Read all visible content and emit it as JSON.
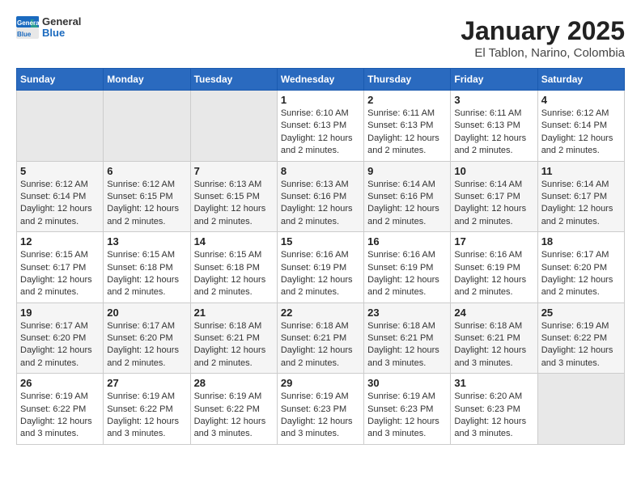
{
  "header": {
    "logo_line1": "General",
    "logo_line2": "Blue",
    "month": "January 2025",
    "location": "El Tablon, Narino, Colombia"
  },
  "weekdays": [
    "Sunday",
    "Monday",
    "Tuesday",
    "Wednesday",
    "Thursday",
    "Friday",
    "Saturday"
  ],
  "weeks": [
    [
      {
        "day": "",
        "info": ""
      },
      {
        "day": "",
        "info": ""
      },
      {
        "day": "",
        "info": ""
      },
      {
        "day": "1",
        "info": "Sunrise: 6:10 AM\nSunset: 6:13 PM\nDaylight: 12 hours and 2 minutes."
      },
      {
        "day": "2",
        "info": "Sunrise: 6:11 AM\nSunset: 6:13 PM\nDaylight: 12 hours and 2 minutes."
      },
      {
        "day": "3",
        "info": "Sunrise: 6:11 AM\nSunset: 6:13 PM\nDaylight: 12 hours and 2 minutes."
      },
      {
        "day": "4",
        "info": "Sunrise: 6:12 AM\nSunset: 6:14 PM\nDaylight: 12 hours and 2 minutes."
      }
    ],
    [
      {
        "day": "5",
        "info": "Sunrise: 6:12 AM\nSunset: 6:14 PM\nDaylight: 12 hours and 2 minutes."
      },
      {
        "day": "6",
        "info": "Sunrise: 6:12 AM\nSunset: 6:15 PM\nDaylight: 12 hours and 2 minutes."
      },
      {
        "day": "7",
        "info": "Sunrise: 6:13 AM\nSunset: 6:15 PM\nDaylight: 12 hours and 2 minutes."
      },
      {
        "day": "8",
        "info": "Sunrise: 6:13 AM\nSunset: 6:16 PM\nDaylight: 12 hours and 2 minutes."
      },
      {
        "day": "9",
        "info": "Sunrise: 6:14 AM\nSunset: 6:16 PM\nDaylight: 12 hours and 2 minutes."
      },
      {
        "day": "10",
        "info": "Sunrise: 6:14 AM\nSunset: 6:17 PM\nDaylight: 12 hours and 2 minutes."
      },
      {
        "day": "11",
        "info": "Sunrise: 6:14 AM\nSunset: 6:17 PM\nDaylight: 12 hours and 2 minutes."
      }
    ],
    [
      {
        "day": "12",
        "info": "Sunrise: 6:15 AM\nSunset: 6:17 PM\nDaylight: 12 hours and 2 minutes."
      },
      {
        "day": "13",
        "info": "Sunrise: 6:15 AM\nSunset: 6:18 PM\nDaylight: 12 hours and 2 minutes."
      },
      {
        "day": "14",
        "info": "Sunrise: 6:15 AM\nSunset: 6:18 PM\nDaylight: 12 hours and 2 minutes."
      },
      {
        "day": "15",
        "info": "Sunrise: 6:16 AM\nSunset: 6:19 PM\nDaylight: 12 hours and 2 minutes."
      },
      {
        "day": "16",
        "info": "Sunrise: 6:16 AM\nSunset: 6:19 PM\nDaylight: 12 hours and 2 minutes."
      },
      {
        "day": "17",
        "info": "Sunrise: 6:16 AM\nSunset: 6:19 PM\nDaylight: 12 hours and 2 minutes."
      },
      {
        "day": "18",
        "info": "Sunrise: 6:17 AM\nSunset: 6:20 PM\nDaylight: 12 hours and 2 minutes."
      }
    ],
    [
      {
        "day": "19",
        "info": "Sunrise: 6:17 AM\nSunset: 6:20 PM\nDaylight: 12 hours and 2 minutes."
      },
      {
        "day": "20",
        "info": "Sunrise: 6:17 AM\nSunset: 6:20 PM\nDaylight: 12 hours and 2 minutes."
      },
      {
        "day": "21",
        "info": "Sunrise: 6:18 AM\nSunset: 6:21 PM\nDaylight: 12 hours and 2 minutes."
      },
      {
        "day": "22",
        "info": "Sunrise: 6:18 AM\nSunset: 6:21 PM\nDaylight: 12 hours and 2 minutes."
      },
      {
        "day": "23",
        "info": "Sunrise: 6:18 AM\nSunset: 6:21 PM\nDaylight: 12 hours and 3 minutes."
      },
      {
        "day": "24",
        "info": "Sunrise: 6:18 AM\nSunset: 6:21 PM\nDaylight: 12 hours and 3 minutes."
      },
      {
        "day": "25",
        "info": "Sunrise: 6:19 AM\nSunset: 6:22 PM\nDaylight: 12 hours and 3 minutes."
      }
    ],
    [
      {
        "day": "26",
        "info": "Sunrise: 6:19 AM\nSunset: 6:22 PM\nDaylight: 12 hours and 3 minutes."
      },
      {
        "day": "27",
        "info": "Sunrise: 6:19 AM\nSunset: 6:22 PM\nDaylight: 12 hours and 3 minutes."
      },
      {
        "day": "28",
        "info": "Sunrise: 6:19 AM\nSunset: 6:22 PM\nDaylight: 12 hours and 3 minutes."
      },
      {
        "day": "29",
        "info": "Sunrise: 6:19 AM\nSunset: 6:23 PM\nDaylight: 12 hours and 3 minutes."
      },
      {
        "day": "30",
        "info": "Sunrise: 6:19 AM\nSunset: 6:23 PM\nDaylight: 12 hours and 3 minutes."
      },
      {
        "day": "31",
        "info": "Sunrise: 6:20 AM\nSunset: 6:23 PM\nDaylight: 12 hours and 3 minutes."
      },
      {
        "day": "",
        "info": ""
      }
    ]
  ]
}
